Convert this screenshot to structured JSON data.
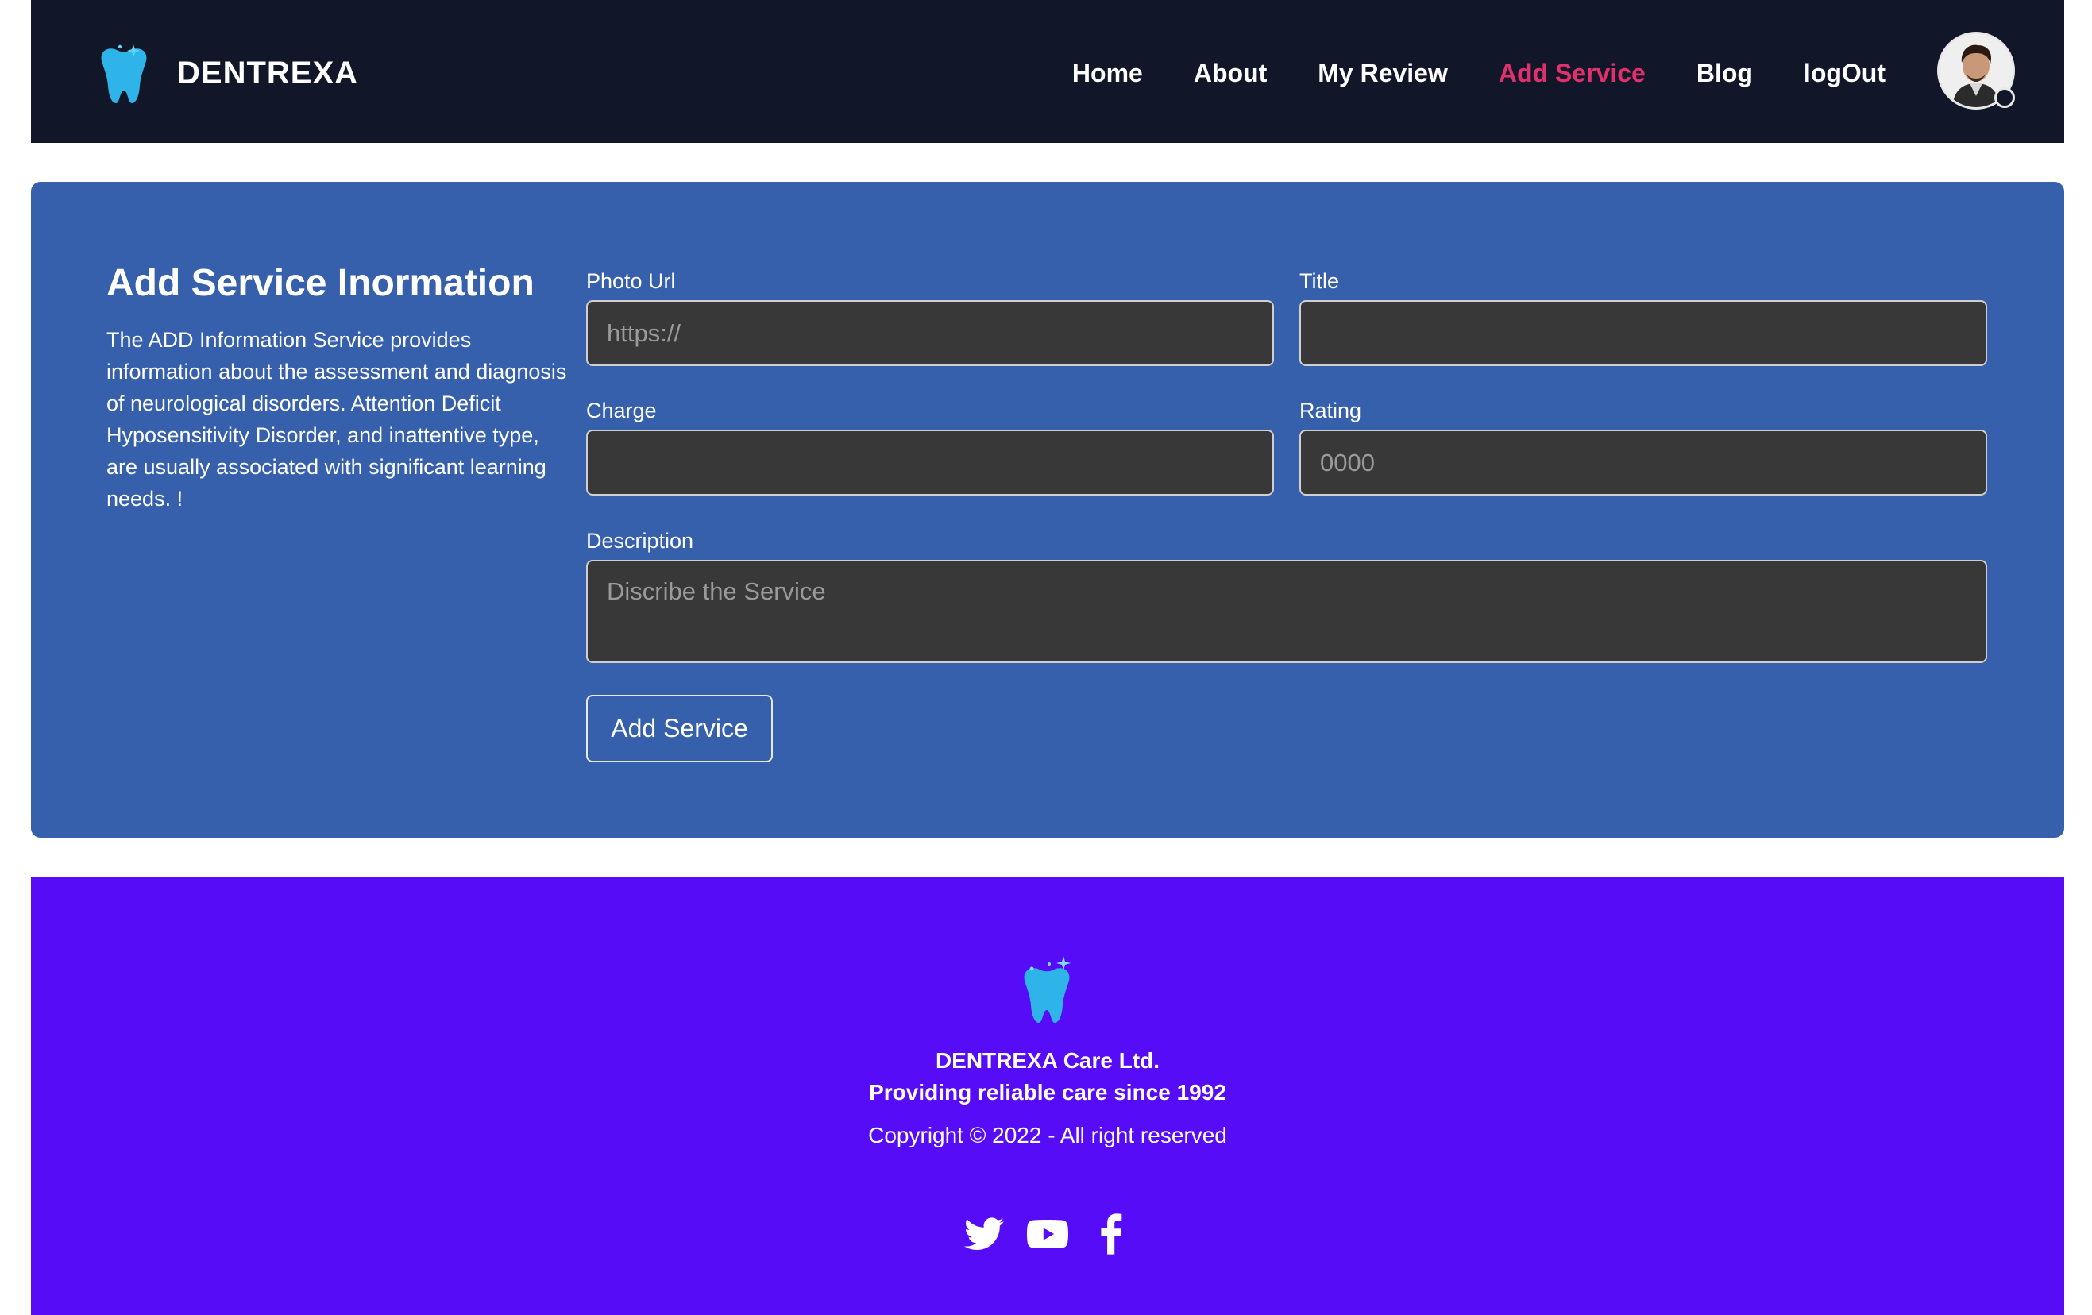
{
  "header": {
    "brand": "DENTREXA",
    "nav": [
      {
        "label": "Home",
        "active": false
      },
      {
        "label": "About",
        "active": false
      },
      {
        "label": "My Review",
        "active": false
      },
      {
        "label": "Add Service",
        "active": true
      },
      {
        "label": "Blog",
        "active": false
      },
      {
        "label": "logOut",
        "active": false
      }
    ],
    "icons": {
      "logo": "tooth-icon",
      "avatar": "user-avatar"
    }
  },
  "form_section": {
    "title": "Add Service Inormation",
    "description": "The ADD Information Service provides information about the assessment and diagnosis of neurological disorders. Attention Deficit Hyposensitivity Disorder, and inattentive type, are usually associated with significant learning needs. !",
    "fields": {
      "photo_url": {
        "label": "Photo Url",
        "value": "",
        "placeholder": "https://"
      },
      "title": {
        "label": "Title",
        "value": "",
        "placeholder": ""
      },
      "charge": {
        "label": "Charge",
        "value": "",
        "placeholder": ""
      },
      "rating": {
        "label": "Rating",
        "value": "",
        "placeholder": "0000"
      },
      "description": {
        "label": "Description",
        "value": "",
        "placeholder": "Discribe the Service"
      }
    },
    "submit_label": "Add Service"
  },
  "footer": {
    "company": "DENTREXA Care Ltd.",
    "tagline": "Providing reliable care since 1992",
    "copyright": "Copyright © 2022 - All right reserved",
    "socials": [
      "twitter-icon",
      "youtube-icon",
      "facebook-icon"
    ]
  },
  "colors": {
    "nav_bg": "#111729",
    "active_link": "#e1306c",
    "card_bg": "#3660ab",
    "input_bg": "#383838",
    "footer_bg": "#570cf8",
    "tooth": "#2fb4e9"
  }
}
